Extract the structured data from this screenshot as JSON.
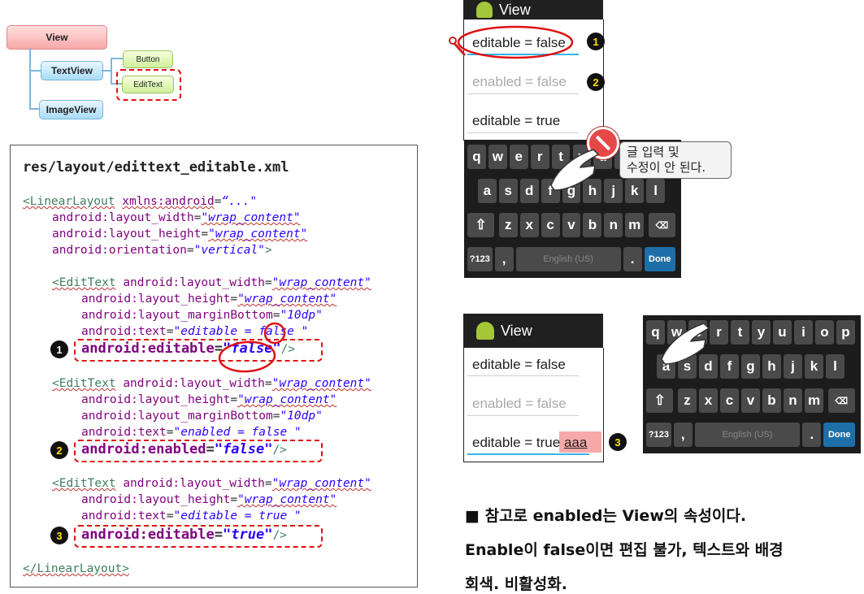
{
  "hierarchy": {
    "view": "View",
    "textview": "TextView",
    "button": "Button",
    "edittext": "EditText",
    "imageview": "ImageView"
  },
  "code": {
    "title": "res/layout/edittext_editable.xml",
    "linear_open": "<LinearLayout",
    "xmlns": "xmlns:android",
    "xmlns_val": "“...\"",
    "lw": "android:layout_width",
    "lh": "android:layout_height",
    "orient": "android:orientation",
    "wrap": "\"wrap_content\"",
    "vertical": "\"vertical\"",
    "edit_open": "<EditText",
    "mb": "android:layout_marginBottom",
    "mb_val": "\"10dp\"",
    "text_attr": "android:text",
    "text1": "\"editable = false \"",
    "text2": "\"enabled = false \"",
    "text3": "\"editable = true \"",
    "editable_attr": "android:editable",
    "enabled_attr": "android:enabled",
    "false_val": "\"false\"",
    "true_val": "\"true\"",
    "close_slash": "/>",
    "close_gt": ">",
    "linear_close": "</LinearLayout>",
    "eq": "="
  },
  "markers": {
    "one": "1",
    "two": "2",
    "three": "3"
  },
  "phone1": {
    "title": "View",
    "field1": "editable = false",
    "field2": "enabled = false",
    "field3": "editable = true"
  },
  "phone2": {
    "title": "View",
    "field1": "editable = false",
    "field2": "enabled = false",
    "field3": "editable = true",
    "typed": "aaa"
  },
  "keyboard": {
    "row1": [
      "q",
      "w",
      "e",
      "r",
      "t",
      "y",
      "u",
      "i",
      "o",
      "p"
    ],
    "row2": [
      "a",
      "s",
      "d",
      "f",
      "g",
      "h",
      "j",
      "k",
      "l"
    ],
    "row3": [
      "z",
      "x",
      "c",
      "v",
      "b",
      "n",
      "m"
    ],
    "sym": "?123",
    "comma": ",",
    "space": "English (US)",
    "period": ".",
    "done": "Done"
  },
  "callout": {
    "line1": "글 입력 및",
    "line2": "수정이 안 된다."
  },
  "note": {
    "line1": "■ 참고로 enabled는 View의 속성이다.",
    "line2": "Enable이 false이면 편집 불가, 텍스트와 배경",
    "line3": "회색. 비활성화."
  }
}
